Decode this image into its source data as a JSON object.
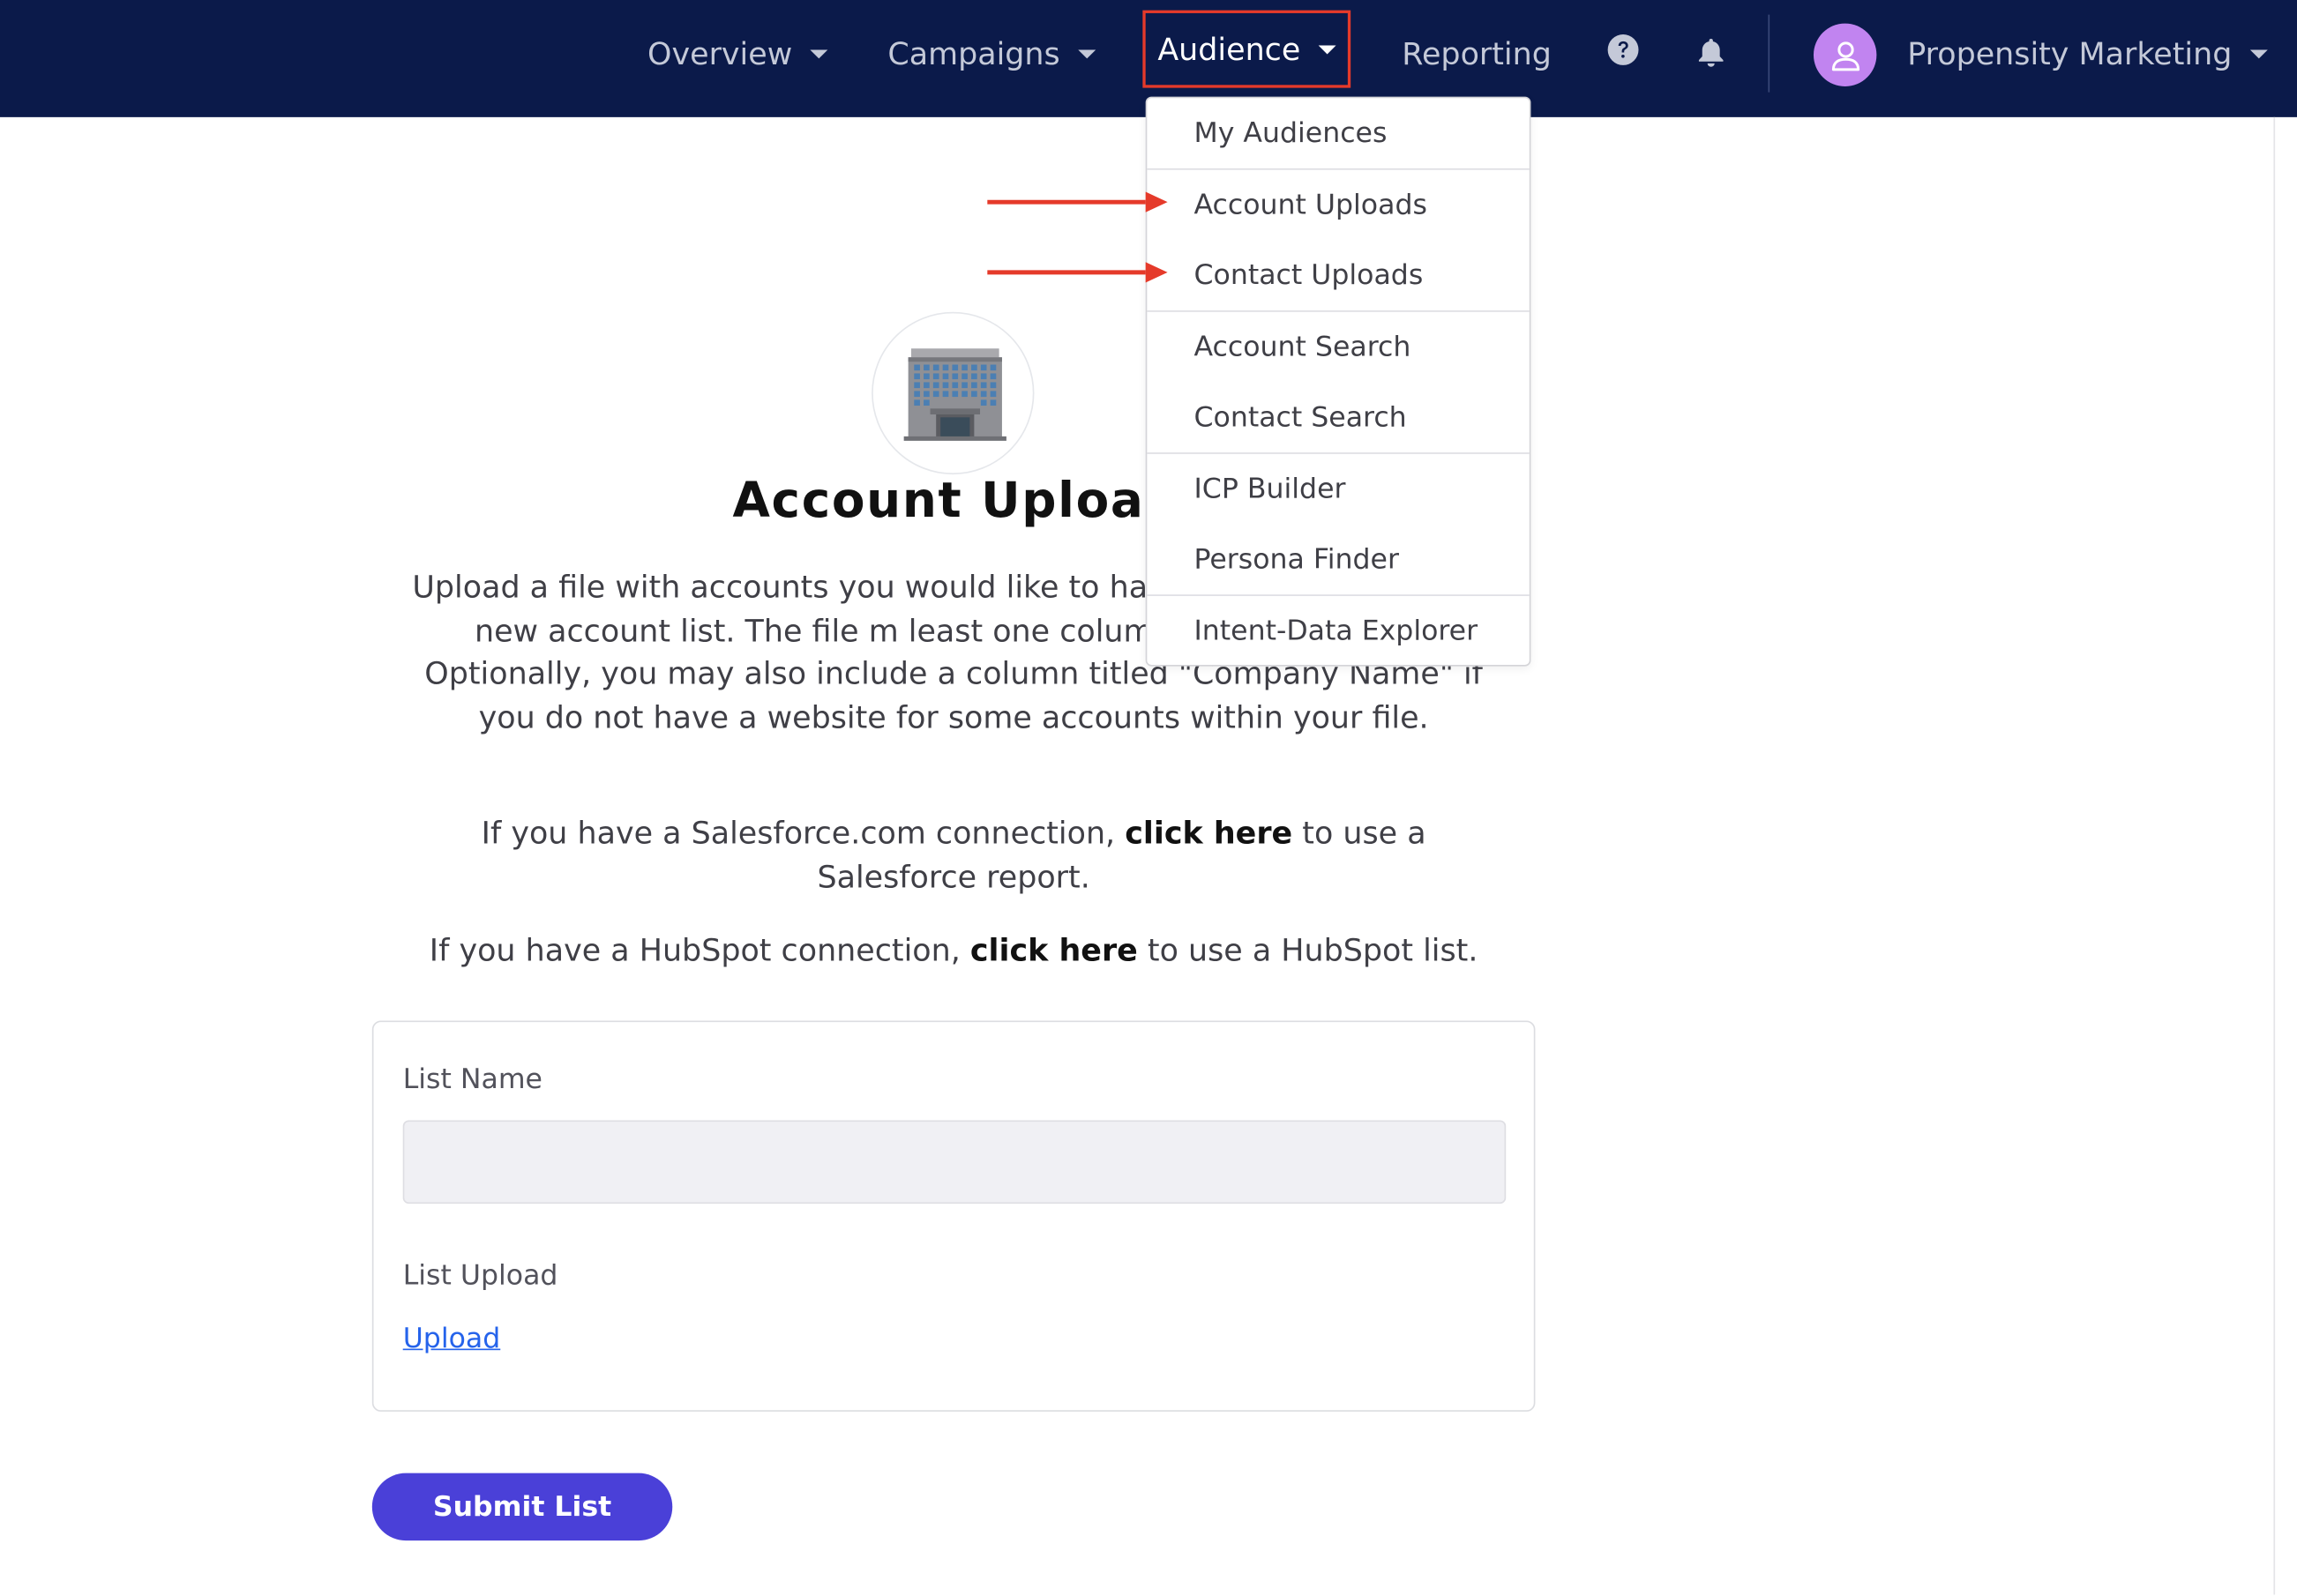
{
  "nav": {
    "items": [
      "Overview",
      "Campaigns",
      "Audience",
      "Reporting"
    ],
    "help_icon": "question-circle-icon",
    "bell_icon": "bell-icon",
    "user_name": "Propensity Marketing"
  },
  "menu": {
    "items": [
      "My Audiences",
      "Account Uploads",
      "Contact Uploads",
      "Account Search",
      "Contact Search",
      "ICP Builder",
      "Persona Finder",
      "Intent-Data Explorer"
    ],
    "highlighted": [
      "Account Uploads",
      "Contact Uploads"
    ]
  },
  "page": {
    "title": "Account Uploac",
    "intro": "Upload a file with accounts you would like to hav database to create a new account list. The file m least one column titled \"Website\". Optionally, you may also include a column titled \"Company Name\" if you do not have a website for some accounts within your file.",
    "salesforce": {
      "before": "If you have a Salesforce.com connection, ",
      "link": "click here",
      "after": " to use a Salesforce report."
    },
    "hubspot": {
      "before": "If you have a HubSpot connection, ",
      "link": "click here",
      "after": " to use a HubSpot list."
    }
  },
  "form": {
    "list_name_label": "List Name",
    "list_name_value": "",
    "list_upload_label": "List Upload",
    "upload_link": "Upload",
    "submit_label": "Submit List"
  },
  "colors": {
    "nav_bg": "#0b1a4a",
    "highlight_red": "#e53a2a",
    "submit_bg": "#4a40d8",
    "avatar_bg": "#c184f0",
    "link_blue": "#2563eb"
  }
}
